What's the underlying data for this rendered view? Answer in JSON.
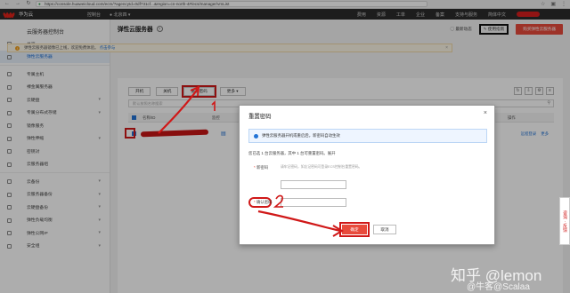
{
  "browser": {
    "url": "https://console.huaweicloud.com/ecm/?agencyId=0df731cf...&region=cn-north-4#/ecs/manager/vmList"
  },
  "topnav": {
    "brand": "华为云",
    "console_link": "控制台",
    "region": "北京四",
    "menu": [
      "费用",
      "资源",
      "工单",
      "企业",
      "备案",
      "支持与服务",
      "简体中文"
    ]
  },
  "sidebar": {
    "title": "云服务器控制台",
    "items": [
      {
        "label": "总览",
        "active": false,
        "chevron": false
      },
      {
        "label": "弹性云服务器",
        "active": true,
        "chevron": false
      },
      {
        "label": "专属主机",
        "active": false,
        "chevron": false
      },
      {
        "label": "裸金属服务器",
        "active": false,
        "chevron": false
      },
      {
        "label": "云硬盘",
        "active": false,
        "chevron": true
      },
      {
        "label": "专属分布式存储",
        "active": false,
        "chevron": true
      },
      {
        "label": "镜像服务",
        "active": false,
        "chevron": false
      },
      {
        "label": "弹性伸缩",
        "active": false,
        "chevron": true
      },
      {
        "label": "密钥对",
        "active": false,
        "chevron": false
      },
      {
        "label": "云服务器组",
        "active": false,
        "chevron": false
      },
      {
        "label": "云备份",
        "active": false,
        "chevron": true
      },
      {
        "label": "云服务器备份",
        "active": false,
        "chevron": true
      },
      {
        "label": "云硬盘备份",
        "active": false,
        "chevron": true
      },
      {
        "label": "弹性负载均衡",
        "active": false,
        "chevron": true
      },
      {
        "label": "弹性公网IP",
        "active": false,
        "chevron": true
      },
      {
        "label": "安全组",
        "active": false,
        "chevron": true
      }
    ]
  },
  "page": {
    "title": "弹性云服务器",
    "latest_news": "最新动态",
    "feedback": "使用指南",
    "buy_button": "购买弹性云服务器"
  },
  "notice": {
    "text": "弹性云服务器镜像已上线，欢迎免费体验。",
    "link": "点击参与"
  },
  "toolbar": {
    "buttons": [
      "开机",
      "关机",
      "重置密码",
      "更多 ▾"
    ]
  },
  "search": {
    "placeholder": "默认按照名称搜索"
  },
  "table": {
    "headers": [
      "名称/ID",
      "监控",
      "操作"
    ],
    "row_ops": [
      "远程登录",
      "更多"
    ]
  },
  "modal": {
    "title": "重置密码",
    "info": "弹性云服务器开机或重启后，新密码自动生效",
    "selected_text": "您已选 1 台云服务器，其中 1 台可重置密码。展开",
    "new_password_label": "新密码",
    "new_password_hint": "请牢记密码，如忘记密码可登录ECS控制台重置密码。",
    "confirm_label": "确认密码",
    "ok_button": "确定",
    "cancel_button": "取消"
  },
  "float_tab": "咨询 · 反馈",
  "watermark": {
    "line1": "知乎 @lemon",
    "line2": "@牛客@Scalaa"
  }
}
